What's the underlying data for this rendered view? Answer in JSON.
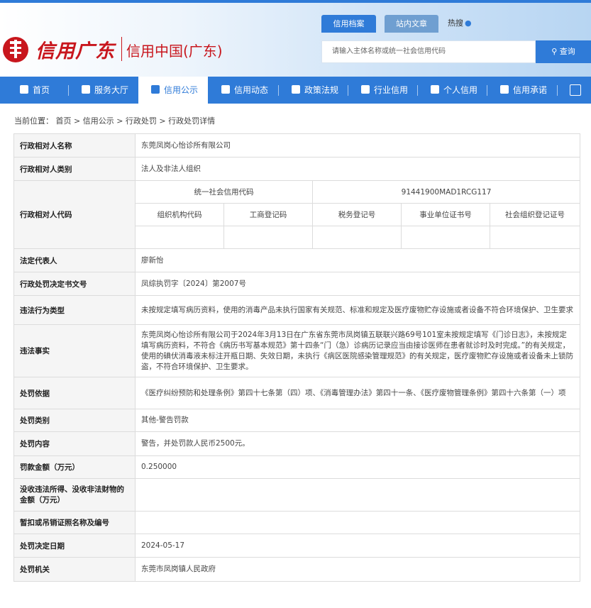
{
  "header": {
    "logo_text": "信用广东",
    "logo_sub": "信用中国(广东)",
    "tabs": [
      {
        "label": "信用档案",
        "active": true
      },
      {
        "label": "站内文章",
        "active": false
      }
    ],
    "hot_search": "热搜",
    "search_placeholder": "请输入主体名称或统一社会信用代码",
    "search_button": "查询"
  },
  "nav": [
    {
      "label": "首页",
      "icon": "home-icon",
      "active": false
    },
    {
      "label": "服务大厅",
      "icon": "grid-icon",
      "active": false
    },
    {
      "label": "信用公示",
      "icon": "announce-icon",
      "active": true
    },
    {
      "label": "信用动态",
      "icon": "news-icon",
      "active": false
    },
    {
      "label": "政策法规",
      "icon": "book-icon",
      "active": false
    },
    {
      "label": "行业信用",
      "icon": "building-icon",
      "active": false
    },
    {
      "label": "个人信用",
      "icon": "id-card-icon",
      "active": false
    },
    {
      "label": "信用承诺",
      "icon": "shield-icon",
      "active": false
    }
  ],
  "breadcrumb": "当前位置： 首页 > 信用公示 > 行政处罚 > 行政处罚详情",
  "record": {
    "name_label": "行政相对人名称",
    "name": "东莞凤岗心怡诊所有限公司",
    "type_label": "行政相对人类别",
    "type": "法人及非法人组织",
    "code_label": "行政相对人代码",
    "uscc_label": "统一社会信用代码",
    "uscc": "91441900MAD1RCG117",
    "sub_labels": [
      "组织机构代码",
      "工商登记码",
      "税务登记号",
      "事业单位证书号",
      "社会组织登记证号"
    ],
    "legal_rep_label": "法定代表人",
    "legal_rep": "廖新怡",
    "doc_no_label": "行政处罚决定书文号",
    "doc_no": "凤综执罚字〔2024〕第2007号",
    "violation_type_label": "违法行为类型",
    "violation_type": "未按规定填写病历资料，使用的消毒产品未执行国家有关规范、标准和规定及医疗废物贮存设施或者设备不符合环境保护、卫生要求",
    "facts_label": "违法事实",
    "facts": "东莞凤岗心怡诊所有限公司于2024年3月13日在广东省东莞市凤岗镇五联联兴路69号101室未按规定填写《门诊日志》，未按规定填写病历资料，不符合《病历书写基本规范》第十四条“门（急）诊病历记录应当由接诊医师在患者就诊时及时完成。”的有关规定，使用的碘伏消毒液未标注开瓶日期、失效日期，未执行《病区医院感染管理规范》的有关规定，医疗废物贮存设施或者设备未上锁防盗，不符合环境保护、卫生要求。",
    "basis_label": "处罚依据",
    "basis": "《医疗纠纷预防和处理条例》第四十七条第（四）项、《消毒管理办法》第四十一条、《医疗废物管理条例》第四十六条第（一）项",
    "category_label": "处罚类别",
    "category": "其他-警告罚款",
    "content_label": "处罚内容",
    "content": "警告，并处罚款人民币2500元。",
    "amount_label": "罚款金额（万元）",
    "amount": "0.250000",
    "confiscation_label": "没收违法所得、没收非法财物的金额（万元）",
    "confiscation": "",
    "license_label": "暂扣或吊销证照名称及编号",
    "license": "",
    "date_label": "处罚决定日期",
    "date": "2024-05-17",
    "authority_label": "处罚机关",
    "authority": "东莞市凤岗镇人民政府"
  }
}
